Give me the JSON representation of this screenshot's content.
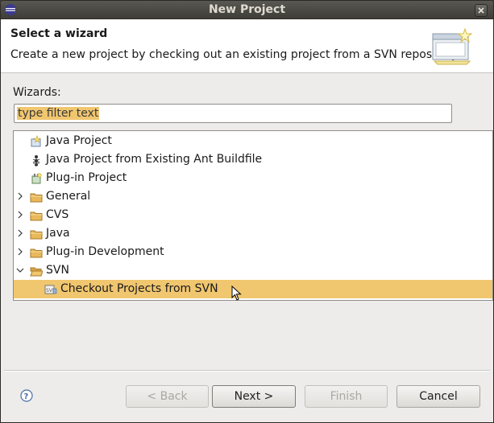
{
  "window": {
    "title": "New Project"
  },
  "header": {
    "title": "Select a wizard",
    "description": "Create a new project by checking out an existing project from a SVN repository."
  },
  "wizards": {
    "label": "Wizards:",
    "filter_text": "type filter text"
  },
  "tree": {
    "items": [
      {
        "label": "Java Project",
        "icon": "java-project-icon",
        "expanded": null
      },
      {
        "label": "Java Project from Existing Ant Buildfile",
        "icon": "ant-icon",
        "expanded": null
      },
      {
        "label": "Plug-in Project",
        "icon": "plugin-project-icon",
        "expanded": null
      },
      {
        "label": "General",
        "icon": "folder-icon",
        "expanded": false
      },
      {
        "label": "CVS",
        "icon": "folder-icon",
        "expanded": false
      },
      {
        "label": "Java",
        "icon": "folder-icon",
        "expanded": false
      },
      {
        "label": "Plug-in Development",
        "icon": "folder-icon",
        "expanded": false
      },
      {
        "label": "SVN",
        "icon": "folder-icon",
        "expanded": true
      },
      {
        "label": "Checkout Projects from SVN",
        "icon": "svn-checkout-icon",
        "selected": true
      }
    ]
  },
  "buttons": {
    "back": "< Back",
    "next": "Next >",
    "finish": "Finish",
    "cancel": "Cancel"
  },
  "colors": {
    "selection": "#f0c66f",
    "titlebar": "#4b4944",
    "background": "#edeceb"
  }
}
